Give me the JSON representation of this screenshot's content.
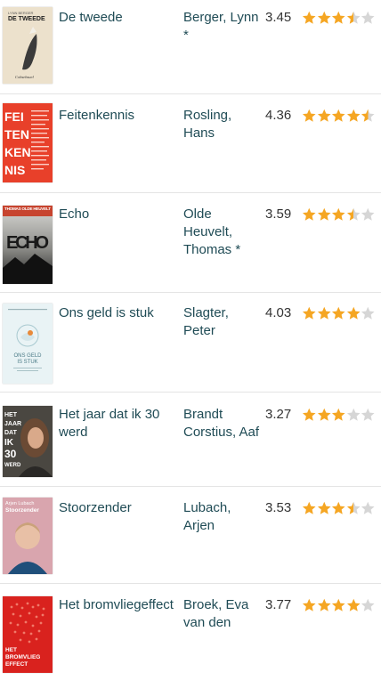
{
  "colors": {
    "star_full": "#f5a623",
    "star_empty": "#d6d6d6",
    "link": "#1f4b55"
  },
  "books": [
    {
      "title": "De tweede",
      "author": "Berger, Lynn *",
      "rating": "3.45",
      "stars": 3.5,
      "cover": {
        "bg": "#e9dcc6",
        "lines": [
          "LYNN BERGER",
          "DE TWEEDE"
        ],
        "footer": "Cobsebsuel"
      }
    },
    {
      "title": "Feitenkennis",
      "author": "Rosling, Hans",
      "rating": "4.36",
      "stars": 4.5,
      "cover": {
        "bg": "#e8402a",
        "lines": [
          "FEI",
          "TEN",
          "KEN",
          "NIS"
        ]
      }
    },
    {
      "title": "Echo",
      "author": "Olde Heuvelt, Thomas *",
      "rating": "3.59",
      "stars": 3.5,
      "cover": {
        "bg": "#2b2b2b",
        "lines": [
          "THOMAS OLDE HEUVELT",
          "ECHO"
        ]
      }
    },
    {
      "title": "Ons geld is stuk",
      "author": "Slagter, Peter",
      "rating": "4.03",
      "stars": 4,
      "cover": {
        "bg": "#e6f2f4",
        "lines": [
          "ONS GELD",
          "IS STUK"
        ]
      }
    },
    {
      "title": "Het jaar dat ik 30 werd",
      "author": "Brandt Corstius, Aaf",
      "rating": "3.27",
      "stars": 3,
      "cover": {
        "bg": "#3a3a36",
        "lines": [
          "HET",
          "JAAR",
          "DAT",
          "IK",
          "30",
          "WERD"
        ]
      }
    },
    {
      "title": "Stoorzender",
      "author": "Lubach, Arjen",
      "rating": "3.53",
      "stars": 3.5,
      "cover": {
        "bg": "#d7a6b0",
        "lines": [
          "Arjen Lubach",
          "Stoorzender"
        ]
      }
    },
    {
      "title": "Het bromvliegeffect",
      "author": "Broek, Eva van den",
      "rating": "3.77",
      "stars": 4,
      "cover": {
        "bg": "#d8231f",
        "lines": [
          "HET",
          "BROMVLIEG",
          "EFFECT"
        ]
      }
    }
  ]
}
